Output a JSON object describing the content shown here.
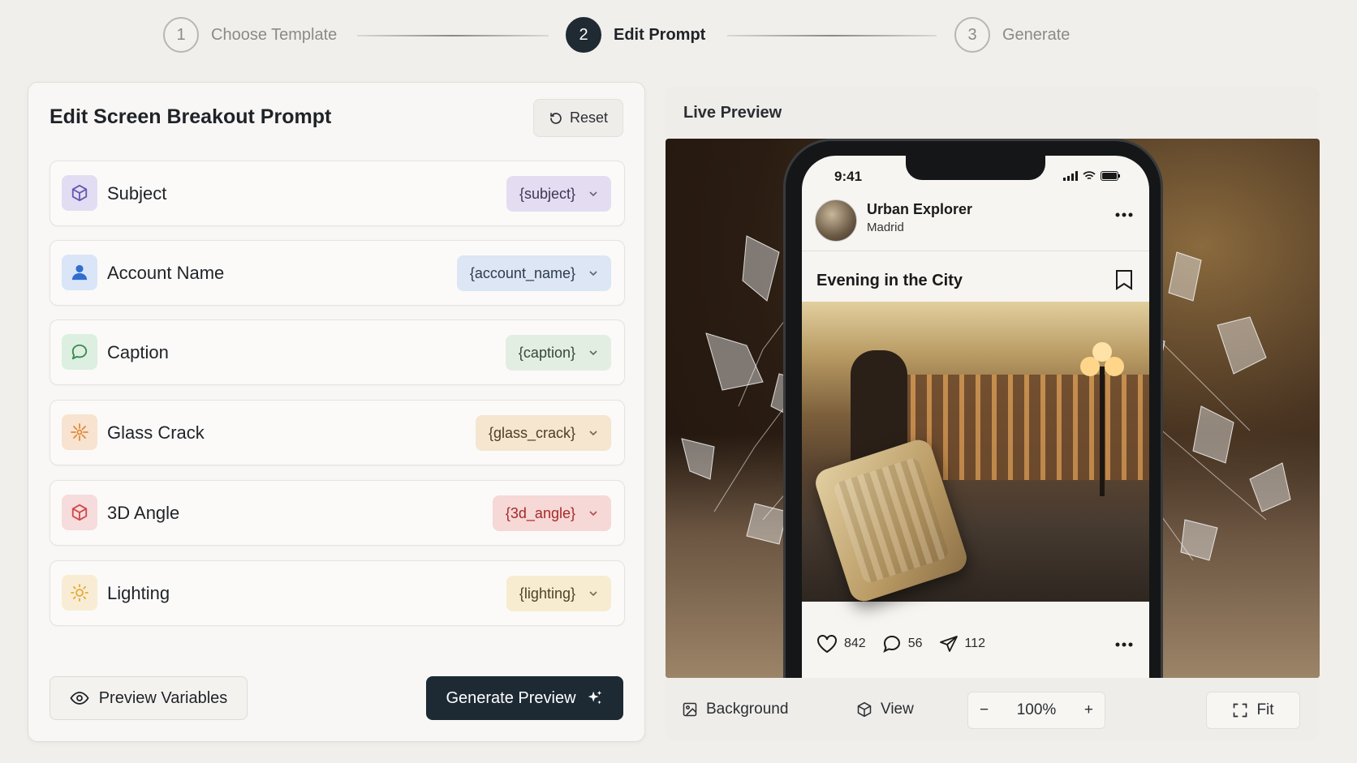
{
  "stepper": {
    "steps": [
      {
        "number": "1",
        "label": "Choose Template",
        "state": "inactive"
      },
      {
        "number": "2",
        "label": "Edit Prompt",
        "state": "active"
      },
      {
        "number": "3",
        "label": "Generate",
        "state": "inactive"
      }
    ]
  },
  "editor": {
    "title": "Edit Screen Breakout Prompt",
    "reset_label": "Reset",
    "variables": [
      {
        "label": "Subject",
        "token": "{subject}",
        "icon": "cube-icon",
        "icon_bg": "#e3ddf3",
        "icon_color": "#6a55b0",
        "pill_bg": "#e4ddf2",
        "pill_color": "#3f3554"
      },
      {
        "label": "Account Name",
        "token": "{account_name}",
        "icon": "user-icon",
        "icon_bg": "#dae6f7",
        "icon_color": "#2f6fd0",
        "pill_bg": "#dce6f4",
        "pill_color": "#2e3b4e"
      },
      {
        "label": "Caption",
        "token": "{caption}",
        "icon": "speech-bubble-icon",
        "icon_bg": "#dcefe0",
        "icon_color": "#3a8a4e",
        "pill_bg": "#e3eee2",
        "pill_color": "#34463a"
      },
      {
        "label": "Glass Crack",
        "token": "{glass_crack}",
        "icon": "burst-icon",
        "icon_bg": "#f7e3cf",
        "icon_color": "#e08a3a",
        "pill_bg": "#f6e5cf",
        "pill_color": "#4e3c28"
      },
      {
        "label": "3D Angle",
        "token": "{3d_angle}",
        "icon": "cube-outline-icon",
        "icon_bg": "#f6dcdc",
        "icon_color": "#d04848",
        "pill_bg": "#f6d8d6",
        "pill_color": "#a52a2a"
      },
      {
        "label": "Lighting",
        "token": "{lighting}",
        "icon": "sun-icon",
        "icon_bg": "#f8edd4",
        "icon_color": "#e5a935",
        "pill_bg": "#f7ecd0",
        "pill_color": "#4e4226"
      }
    ],
    "preview_variables_label": "Preview Variables",
    "generate_preview_label": "Generate Preview"
  },
  "preview": {
    "title": "Live Preview",
    "phone": {
      "time": "9:41",
      "account_name": "Urban Explorer",
      "location": "Madrid",
      "post_title": "Evening in the City",
      "likes": "842",
      "comments": "56",
      "shares": "112"
    },
    "toolbar": {
      "background_label": "Background",
      "view_label": "View",
      "zoom_value": "100%",
      "zoom_out_symbol": "−",
      "zoom_in_symbol": "+",
      "fit_label": "Fit"
    }
  },
  "colors": {
    "accent_dark": "#1d2a34",
    "background": "#f1efeb"
  }
}
